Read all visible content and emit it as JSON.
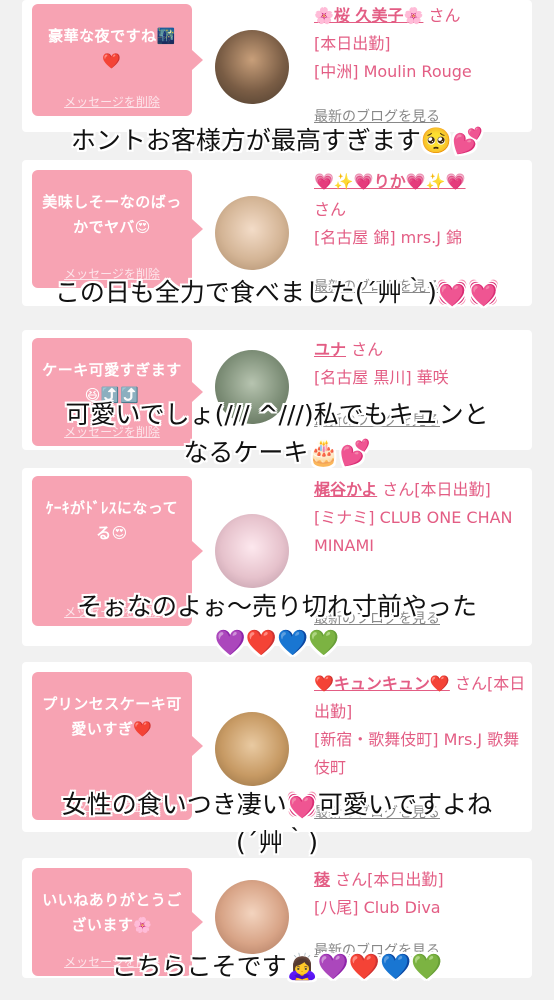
{
  "posts": [
    {
      "message": "豪華な夜ですね🌃❤️",
      "delete_label": "メッセージを削除",
      "name": "🌸桜 久美子🌸",
      "honorific": "さん",
      "details": [
        "[本日出勤]",
        "[中洲] Moulin Rouge"
      ],
      "blog_link": "最新のブログを見る",
      "caption": "ホントお客様方が最高すぎます🥺💕",
      "avatar_color": "#6b5a48"
    },
    {
      "message": "美味しそーなのばっかでヤバ😍",
      "delete_label": "メッセージを削除",
      "name": "💗✨💗りか💗✨💗",
      "honorific": "さん",
      "details": [
        "[名古屋 錦] mrs.J 錦"
      ],
      "blog_link": "最新のブログを見る",
      "caption": "この日も全力で食べました(´艸｀)💓💓",
      "avatar_color": "#d8c3a8"
    },
    {
      "message": "ケーキ可愛すぎます😆⤴️⤴️",
      "delete_label": "メッセージを削除",
      "name": "ユナ",
      "honorific": "さん",
      "details": [
        "[名古屋 黒川] 華咲"
      ],
      "blog_link": "最新のブログを見る",
      "caption_lines": [
        "可愛いでしょ(/// ^///)私でもキュンと",
        "なるケーキ🎂💕"
      ],
      "avatar_color": "#8fa08a"
    },
    {
      "message": "ｹｰｷがﾄﾞﾚｽになってる😍",
      "delete_label": "メッセージを削除",
      "name": "梶谷かよ",
      "honorific": "さん[本日出勤]",
      "details": [
        "[ミナミ] CLUB ONE CHAN MINAMI"
      ],
      "blog_link": "最新のブログを見る",
      "caption_lines": [
        "そぉなのよぉ〜売り切れ寸前やった",
        "💜❤️💙💚"
      ],
      "avatar_color": "#e7c7d0"
    },
    {
      "message": "プリンセスケーキ可愛いすぎ❤️",
      "delete_label": "メッセージを削除",
      "name": "❤️キュンキュン❤️",
      "honorific": "さん[本日出勤]",
      "details": [
        "[新宿・歌舞伎町] Mrs.J 歌舞伎町"
      ],
      "blog_link": "最新のブログを見る",
      "caption_lines": [
        "女性の食いつき凄い💓可愛いですよね",
        "(´艸｀)"
      ],
      "avatar_color": "#c9a36d"
    },
    {
      "message": "いいねありがとうございます🌸",
      "delete_label": "メッセージを削除",
      "name": "稜",
      "honorific": "さん[本日出勤]",
      "details": [
        "[八尾] Club Diva"
      ],
      "blog_link": "最新のブログを見る",
      "caption": "こちらこそです🙇‍♀️💜❤️💙💚",
      "avatar_color": "#d9a08a"
    }
  ]
}
